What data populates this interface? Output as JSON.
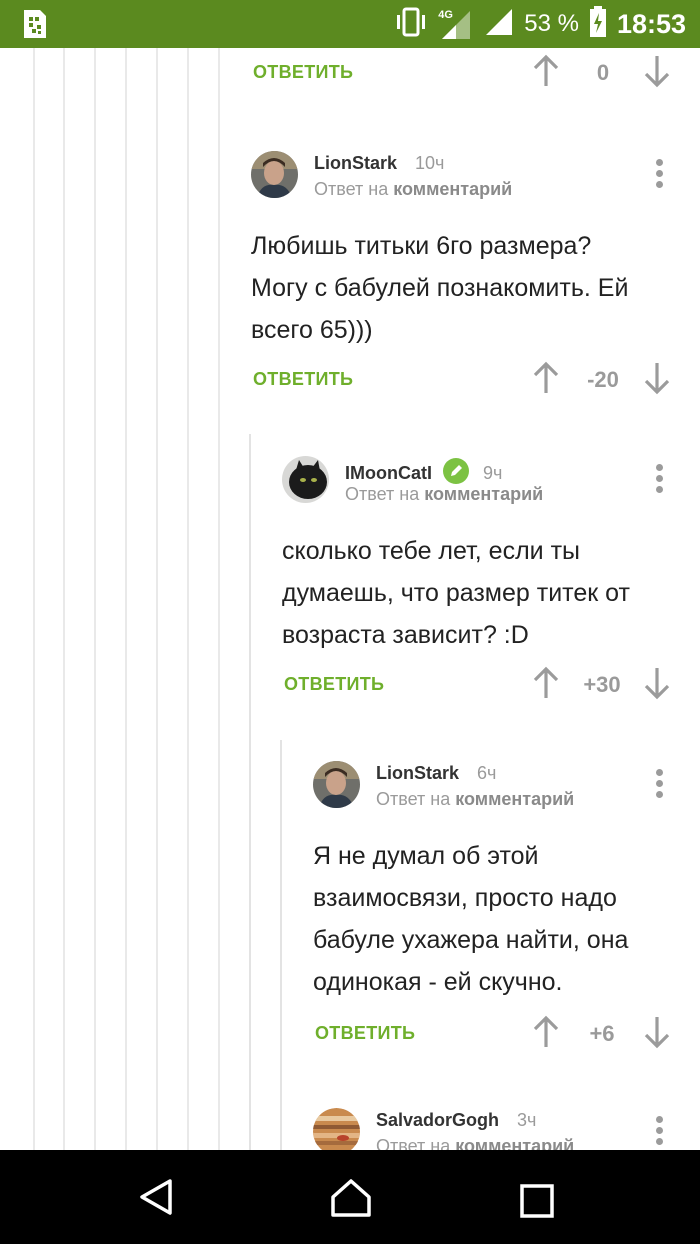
{
  "status_bar": {
    "network": "4G",
    "battery_percent": "53 %",
    "time": "18:53",
    "bg_color": "#5b8a1f"
  },
  "top_action": {
    "reply_label": "ОТВЕТИТЬ",
    "score": "0"
  },
  "comments": [
    {
      "author": "LionStark",
      "time": "10ч",
      "reply_prefix": "Ответ на",
      "reply_target": "комментарий",
      "lines": [
        "Любишь титьки 6го размера?",
        "Могу с бабулей познакомить. Ей",
        "всего 65)))"
      ],
      "reply_label": "ОТВЕТИТЬ",
      "score": "-20"
    },
    {
      "author": "IMoonCatI",
      "time": "9ч",
      "reply_prefix": "Ответ на",
      "reply_target": "комментарий",
      "lines": [
        "сколько тебе лет, если ты",
        "думаешь, что размер титек от",
        "возраста зависит? :D"
      ],
      "reply_label": "ОТВЕТИТЬ",
      "score": "+30"
    },
    {
      "author": "LionStark",
      "time": "6ч",
      "reply_prefix": "Ответ на",
      "reply_target": "комментарий",
      "lines": [
        "Я не думал об этой",
        "взаимосвязи, просто надо",
        "бабуле ухажера найти, она",
        "одинокая - ей скучно."
      ],
      "reply_label": "ОТВЕТИТЬ",
      "score": "+6"
    },
    {
      "author": "SalvadorGogh",
      "time": "3ч",
      "reply_prefix": "Ответ на",
      "reply_target": "комментарий"
    }
  ],
  "icons": {
    "up": "arrow-up-icon",
    "down": "arrow-down-icon",
    "more": "more-vertical-icon",
    "verified": "pencil-badge-icon",
    "nav_back": "back-triangle-icon",
    "nav_home": "home-icon",
    "nav_recents": "recents-square-icon"
  },
  "colors": {
    "accent": "#6faf2c",
    "muted": "#9a9a9a",
    "verified": "#7cc243"
  }
}
